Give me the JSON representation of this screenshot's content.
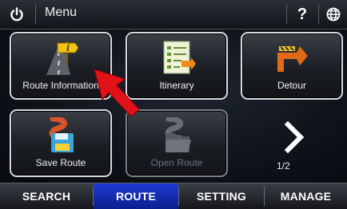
{
  "topbar": {
    "title": "Menu",
    "help_label": "?",
    "icons": [
      "power-icon",
      "help-icon",
      "globe-icon"
    ]
  },
  "tiles": [
    {
      "label": "Route Information",
      "icon": "route-info-icon",
      "enabled": true
    },
    {
      "label": "Itinerary",
      "icon": "itinerary-icon",
      "enabled": true
    },
    {
      "label": "Detour",
      "icon": "detour-icon",
      "enabled": true
    },
    {
      "label": "Save Route",
      "icon": "save-route-icon",
      "enabled": true
    },
    {
      "label": "Open Route",
      "icon": "open-route-icon",
      "enabled": false
    }
  ],
  "pager": {
    "indicator": "1/2",
    "icon": "chevron-right-icon"
  },
  "tabs": [
    {
      "label": "SEARCH",
      "active": false
    },
    {
      "label": "ROUTE",
      "active": true
    },
    {
      "label": "SETTING",
      "active": false
    },
    {
      "label": "MANAGE",
      "active": false
    }
  ],
  "colors": {
    "active_tab": "#1a35c4",
    "pointer": "#e1111a",
    "tile_border": "#d7d9dd"
  }
}
